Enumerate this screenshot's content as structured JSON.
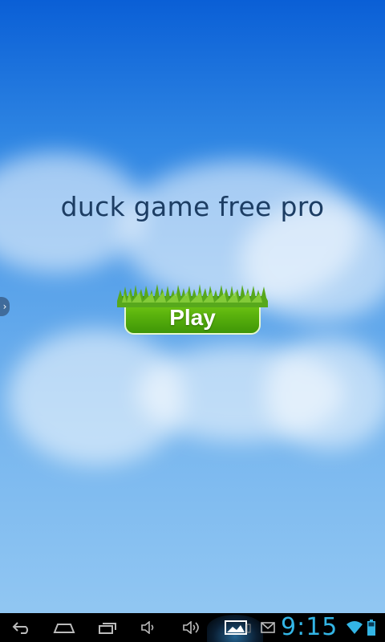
{
  "app": {
    "title": "duck game free pro",
    "play_label": "Play"
  },
  "status_bar": {
    "time": "9:15"
  },
  "navigation": {
    "back_icon": "back-icon",
    "home_icon": "home-icon",
    "recent_apps_icon": "recent-apps-icon",
    "volume_down_icon": "volume-down-icon",
    "volume_up_icon": "volume-up-icon",
    "gallery_icon": "gallery-icon",
    "notification_icon": "gmail-icon",
    "wifi_icon": "wifi-icon",
    "battery_icon": "battery-icon"
  },
  "colors": {
    "sky_top": "#0a5fd6",
    "sky_bottom": "#95c9f3",
    "title_text": "#1c3d63",
    "button_green": "#5bb30d",
    "clock": "#33b5e5"
  }
}
